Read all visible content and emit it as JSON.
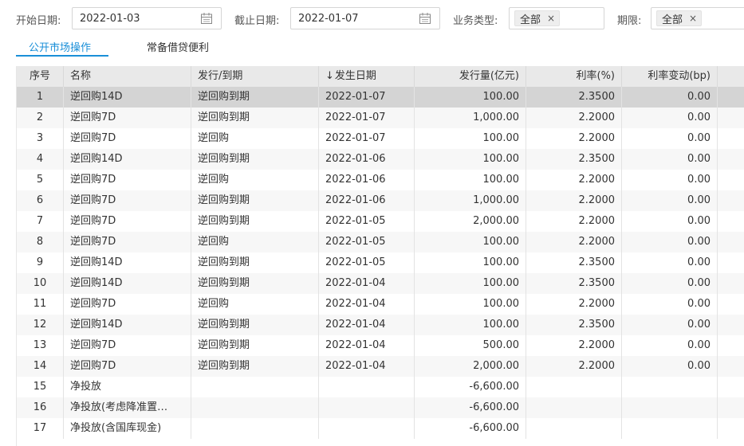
{
  "filters": {
    "start_date_label": "开始日期:",
    "start_date_value": "2022-01-03",
    "end_date_label": "截止日期:",
    "end_date_value": "2022-01-07",
    "biz_type_label": "业务类型:",
    "biz_type_tag": "全部",
    "term_label": "期限:",
    "term_tag": "全部",
    "tag_remove": "×"
  },
  "tabs": [
    {
      "label": "公开市场操作",
      "active": true
    },
    {
      "label": "常备借贷便利",
      "active": false
    }
  ],
  "table": {
    "columns": [
      "序号",
      "名称",
      "发行/到期",
      "发生日期",
      "发行量(亿元)",
      "利率(%)",
      "利率变动(bp)"
    ],
    "sort_arrow": "↓",
    "rows": [
      [
        "1",
        "逆回购14D",
        "逆回购到期",
        "2022-01-07",
        "100.00",
        "2.3500",
        "0.00"
      ],
      [
        "2",
        "逆回购7D",
        "逆回购到期",
        "2022-01-07",
        "1,000.00",
        "2.2000",
        "0.00"
      ],
      [
        "3",
        "逆回购7D",
        "逆回购",
        "2022-01-07",
        "100.00",
        "2.2000",
        "0.00"
      ],
      [
        "4",
        "逆回购14D",
        "逆回购到期",
        "2022-01-06",
        "100.00",
        "2.3500",
        "0.00"
      ],
      [
        "5",
        "逆回购7D",
        "逆回购",
        "2022-01-06",
        "100.00",
        "2.2000",
        "0.00"
      ],
      [
        "6",
        "逆回购7D",
        "逆回购到期",
        "2022-01-06",
        "1,000.00",
        "2.2000",
        "0.00"
      ],
      [
        "7",
        "逆回购7D",
        "逆回购到期",
        "2022-01-05",
        "2,000.00",
        "2.2000",
        "0.00"
      ],
      [
        "8",
        "逆回购7D",
        "逆回购",
        "2022-01-05",
        "100.00",
        "2.2000",
        "0.00"
      ],
      [
        "9",
        "逆回购14D",
        "逆回购到期",
        "2022-01-05",
        "100.00",
        "2.3500",
        "0.00"
      ],
      [
        "10",
        "逆回购14D",
        "逆回购到期",
        "2022-01-04",
        "100.00",
        "2.3500",
        "0.00"
      ],
      [
        "11",
        "逆回购7D",
        "逆回购",
        "2022-01-04",
        "100.00",
        "2.2000",
        "0.00"
      ],
      [
        "12",
        "逆回购14D",
        "逆回购到期",
        "2022-01-04",
        "100.00",
        "2.3500",
        "0.00"
      ],
      [
        "13",
        "逆回购7D",
        "逆回购到期",
        "2022-01-04",
        "500.00",
        "2.2000",
        "0.00"
      ],
      [
        "14",
        "逆回购7D",
        "逆回购到期",
        "2022-01-04",
        "2,000.00",
        "2.2000",
        "0.00"
      ],
      [
        "15",
        "净投放",
        "",
        "",
        "-6,600.00",
        "",
        ""
      ],
      [
        "16",
        "净投放(考虑降准置…",
        "",
        "",
        "-6,600.00",
        "",
        ""
      ],
      [
        "17",
        "净投放(含国库现金)",
        "",
        "",
        "-6,600.00",
        "",
        ""
      ]
    ],
    "selected_row": 0
  },
  "colors": {
    "accent": "#1a8fd8",
    "header_bg": "#e9e9e9",
    "selected_row_bg": "#d4d4d4",
    "stripe_bg": "#f7f7f7"
  },
  "icons": {
    "date_picker": "calendar-icon",
    "tag_remove": "close-icon"
  }
}
